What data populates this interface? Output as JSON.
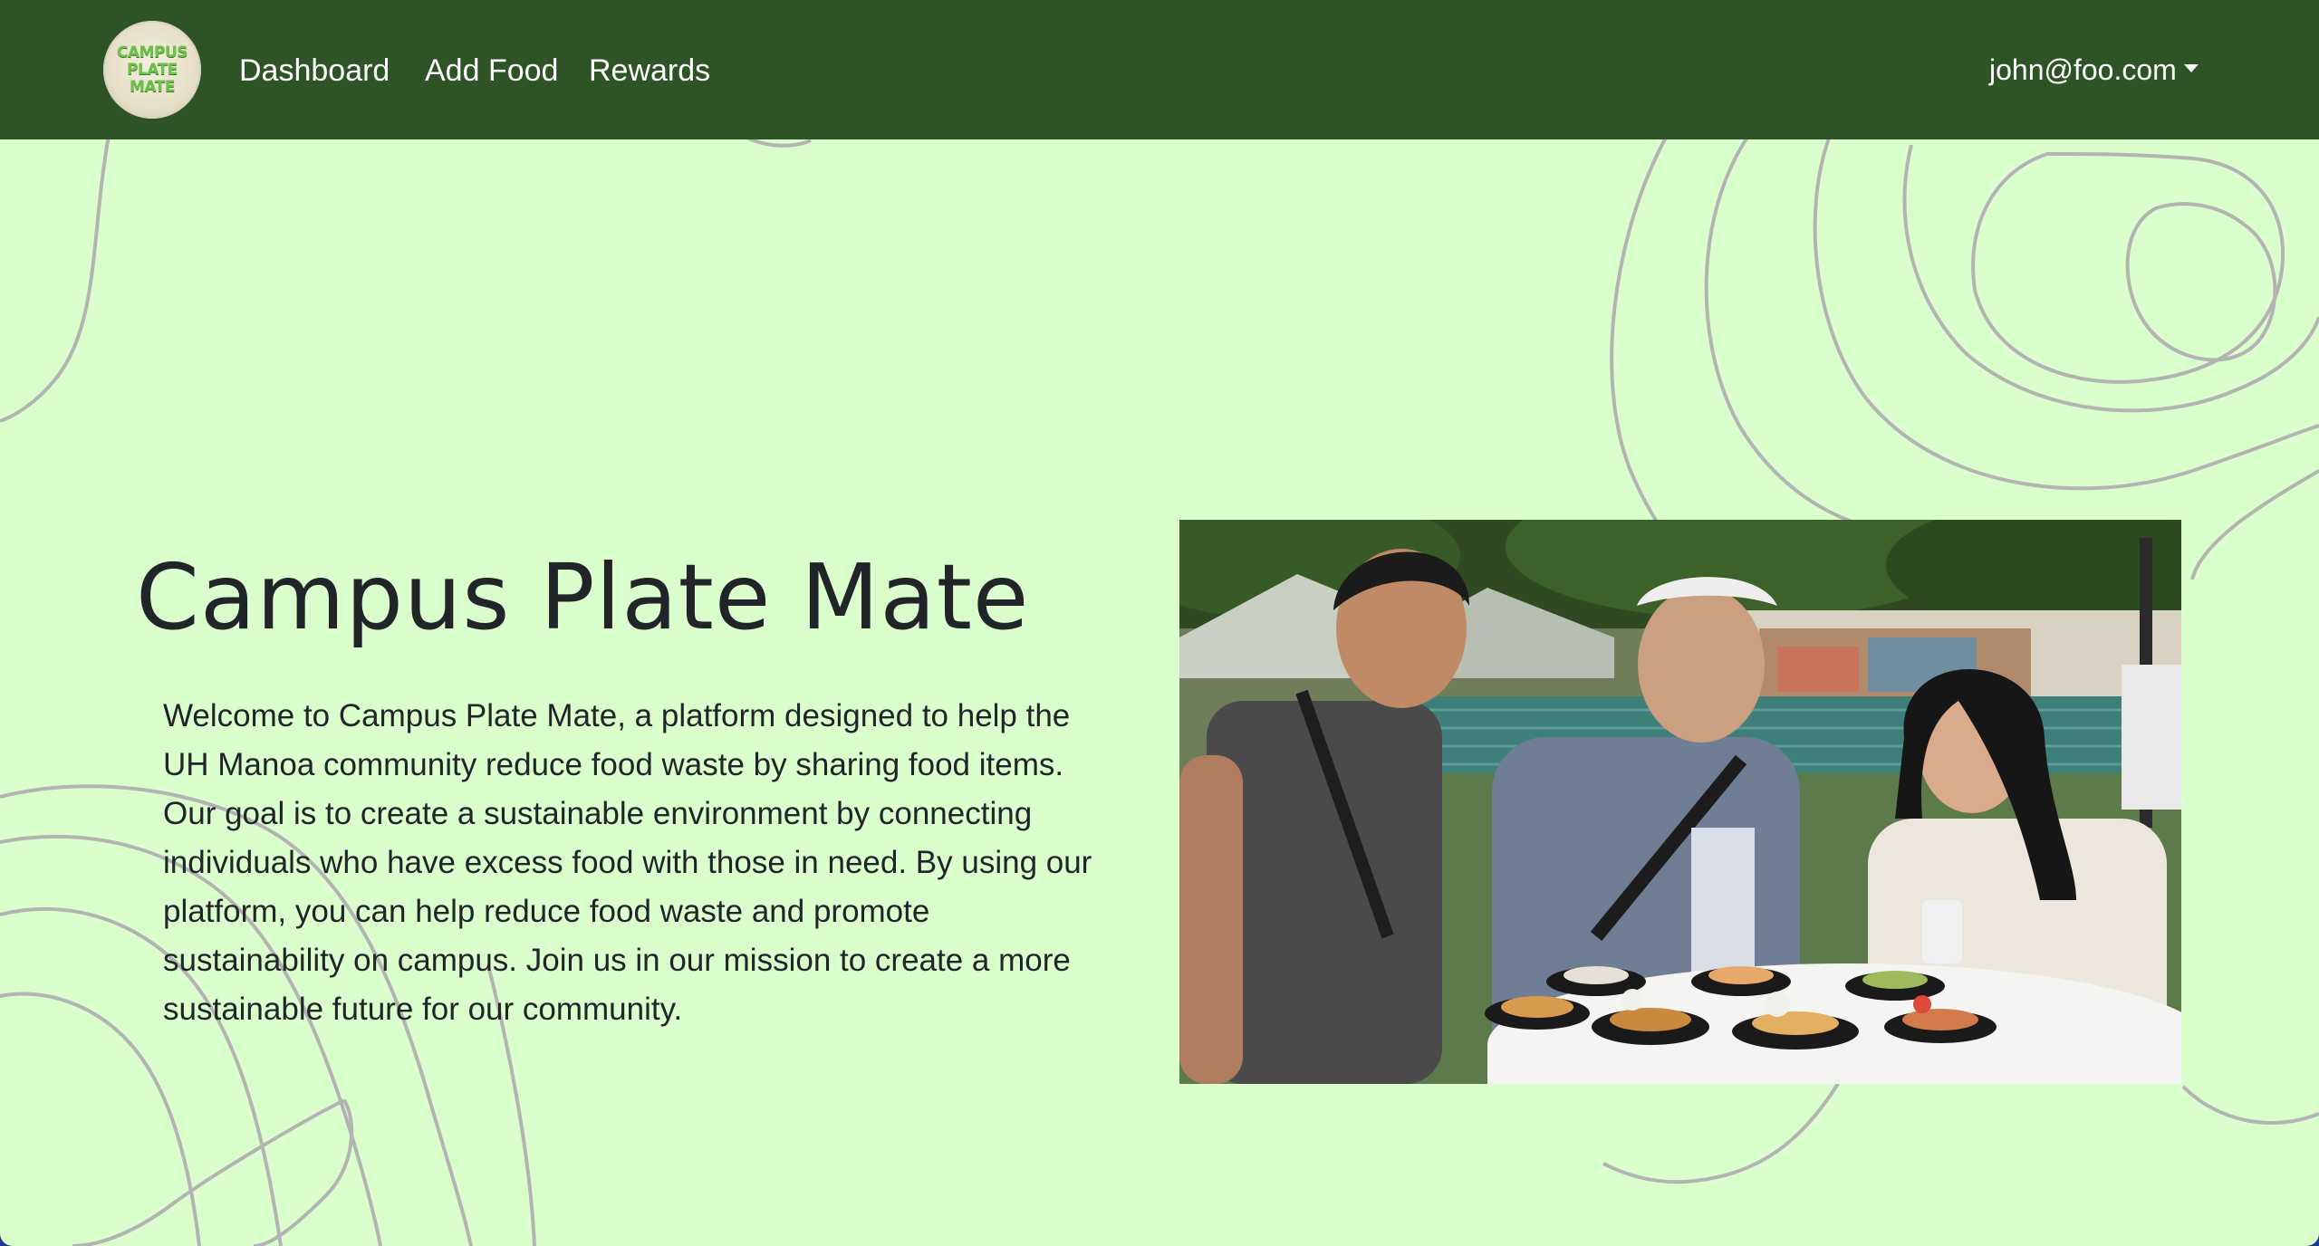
{
  "navbar": {
    "logo_lines": [
      "CAMPUS",
      "PLATE",
      "MATE"
    ],
    "links": [
      {
        "label": "Dashboard"
      },
      {
        "label": "Add Food"
      },
      {
        "label": "Rewards"
      }
    ],
    "user_email": "john@foo.com",
    "background_color": "#2e5326"
  },
  "hero": {
    "title": "Campus Plate Mate",
    "description": "Welcome to Campus Plate Mate, a platform designed to help the UH Manoa community reduce food waste by sharing food items. Our goal is to create a sustainable environment by connecting individuals who have excess food with those in need. By using our platform, you can help reduce food waste and promote sustainability on campus. Join us in our mission to create a more sustainable future for our community.",
    "background_color": "#daffcc"
  },
  "photo": {
    "icon": "photo-of-students-with-food-plates"
  }
}
